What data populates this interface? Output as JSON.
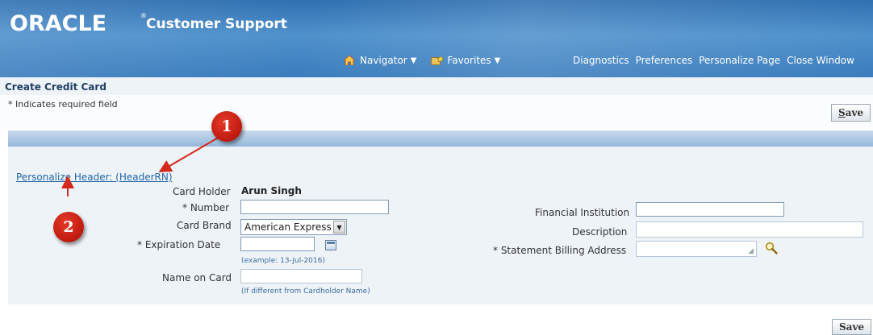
{
  "header": {
    "brand": "ORACLE",
    "brand_mark": "®",
    "product": "Customer Support",
    "nav": [
      {
        "label": "Navigator",
        "icon": "home-icon"
      },
      {
        "label": "Favorites",
        "icon": "favorites-icon"
      }
    ],
    "links": [
      "Diagnostics",
      "Preferences",
      "Personalize Page",
      "Close Window"
    ]
  },
  "page": {
    "title": "Create Credit Card",
    "required_note": "* Indicates required field",
    "save_label_underlined": "S",
    "save_label_rest": "ave",
    "save_bottom": "Save",
    "personalize_link": "Personalize Header: (HeaderRN)"
  },
  "form": {
    "card_holder_label": "Card Holder",
    "card_holder_value": "Arun Singh",
    "number_label": "* Number",
    "number_value": "",
    "card_brand_label": "Card Brand",
    "card_brand_value": "American Express",
    "expiration_label": "* Expiration Date",
    "expiration_hint": "(example: 13-Jul-2016)",
    "name_on_card_label": "Name on Card",
    "name_on_card_hint": "(If different from Cardholder Name)",
    "financial_institution_label": "Financial Institution",
    "description_label": "Description",
    "billing_address_label": "* Statement Billing Address"
  },
  "annotations": {
    "callout_1": "1",
    "callout_2": "2",
    "color": "#c51d12"
  },
  "colors": {
    "banner": "#3a7cbd",
    "link": "#1f66a9",
    "form_background": "#eef3f8"
  }
}
